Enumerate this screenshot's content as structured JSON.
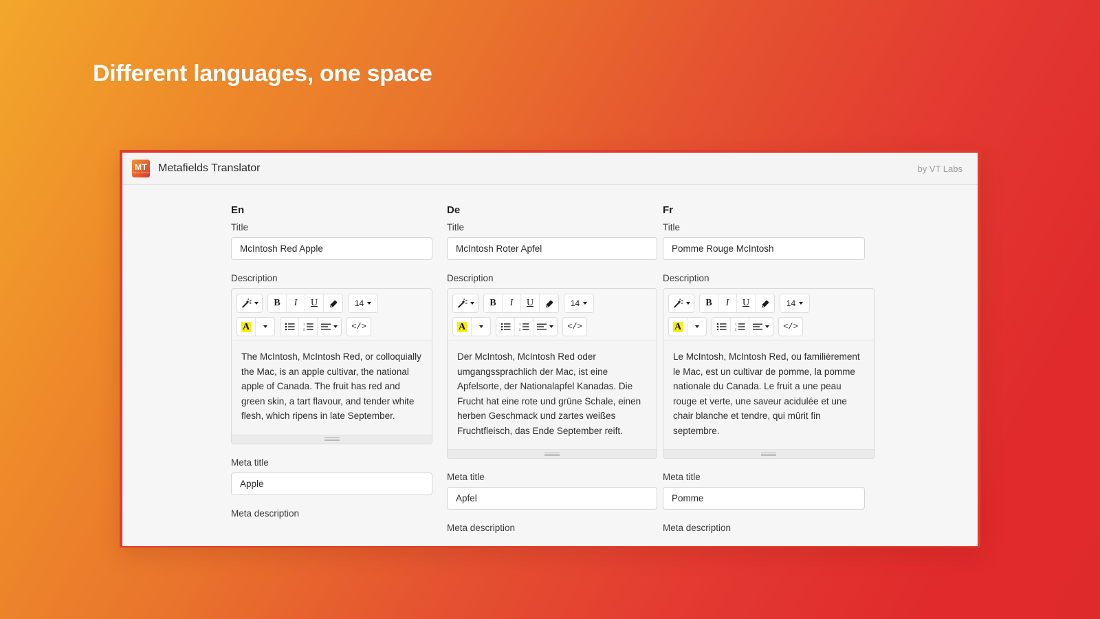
{
  "hero": {
    "heading": "Different languages, one space"
  },
  "background": {
    "gradient_from": "#F2A72B",
    "gradient_mid": "#E9742C",
    "gradient_to": "#DF2A2C"
  },
  "window": {
    "border_color": "#E13B2E",
    "titlebar": {
      "logo_text": "MT",
      "logo_subtext": "METAFIELDS TRANSLATOR",
      "title": "Metafields Translator",
      "byline": "by VT Labs"
    }
  },
  "toolbar": {
    "magic_wand": "magic-wand",
    "bold": "B",
    "italic": "I",
    "underline": "U",
    "eraser": "eraser",
    "font_size": "14",
    "highlight": "A",
    "bullet_list": "bullet-list",
    "numbered_list": "numbered-list",
    "align": "align",
    "code": "</>"
  },
  "labels": {
    "title": "Title",
    "description": "Description",
    "meta_title": "Meta title",
    "meta_description": "Meta description"
  },
  "columns": [
    {
      "lang": "En",
      "title": "McIntosh Red Apple",
      "description": "The McIntosh, McIntosh Red, or colloquially the Mac, is an apple cultivar, the national apple of Canada. The fruit has red and green skin, a tart flavour, and tender white flesh, which ripens in late September.",
      "meta_title": "Apple"
    },
    {
      "lang": "De",
      "title": "McIntosh Roter Apfel",
      "description": "Der McIntosh, McIntosh Red oder umgangssprachlich der Mac, ist eine Apfelsorte, der Nationalapfel Kanadas. Die Frucht hat eine rote und grüne Schale, einen herben Geschmack und zartes weißes Fruchtfleisch, das Ende September reift.",
      "meta_title": "Apfel"
    },
    {
      "lang": "Fr",
      "title": "Pomme Rouge McIntosh",
      "description": "Le McIntosh, McIntosh Red, ou familièrement le Mac, est un cultivar de pomme, la pomme nationale du Canada. Le fruit a une peau rouge et verte, une saveur acidulée et une chair blanche et tendre, qui mûrit fin septembre.",
      "meta_title": "Pomme"
    }
  ]
}
